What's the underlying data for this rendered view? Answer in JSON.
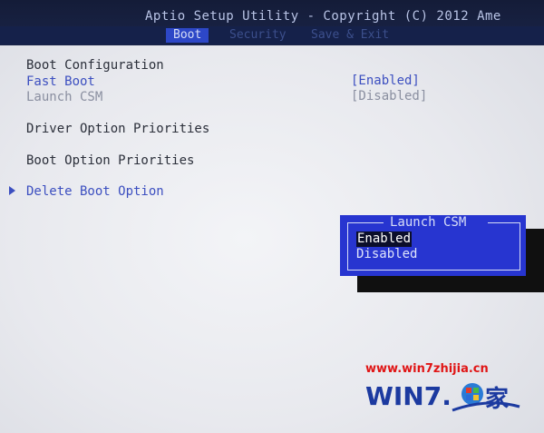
{
  "header": {
    "title": "Aptio Setup Utility - Copyright (C) 2012 Ame",
    "tabs": [
      {
        "label": "Boot",
        "active": true
      },
      {
        "label": "Security",
        "active": false
      },
      {
        "label": "Save & Exit",
        "active": false
      }
    ]
  },
  "boot": {
    "section_title": "Boot Configuration",
    "items": [
      {
        "label": "Fast Boot",
        "value": "[Enabled]"
      },
      {
        "label": "Launch CSM",
        "value": "[Disabled]"
      },
      {
        "label": "Driver Option Priorities"
      },
      {
        "label": "Boot Option Priorities"
      },
      {
        "label": "Delete Boot Option"
      }
    ]
  },
  "popup": {
    "title": "Launch CSM",
    "options": [
      {
        "label": "Enabled",
        "selected": true
      },
      {
        "label": "Disabled",
        "selected": false
      }
    ]
  },
  "watermark": {
    "url": "www.win7zhijia.cn",
    "logo_text": "WIN7.",
    "logo_char": "家"
  },
  "colors": {
    "header_bg": "#141c38",
    "active_tab": "#2d47c7",
    "link_text": "#3c4fc0",
    "popup_bg": "#2735d0",
    "watermark_red": "#e01515",
    "watermark_blue": "#1c3aa0"
  }
}
